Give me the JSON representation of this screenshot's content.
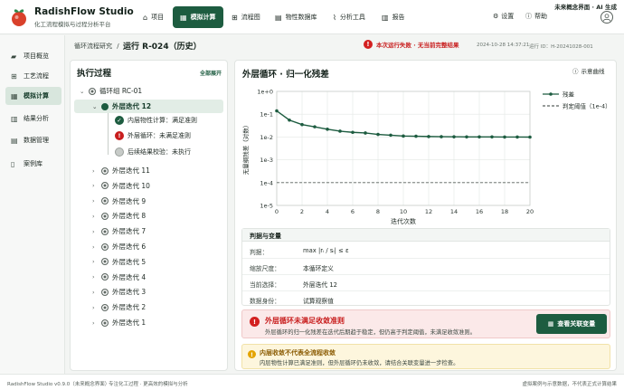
{
  "app": {
    "title": "RadishFlow Studio",
    "subtitle": "化工流程模拟与过程分析平台",
    "concept_tag": "未来概念界面 · AI 生成",
    "brand_color": "#1d5c40"
  },
  "nav": [
    {
      "label": "项目",
      "icon": "home-icon",
      "active": false
    },
    {
      "label": "模拟计算",
      "icon": "grid-icon",
      "active": true
    },
    {
      "label": "流程图",
      "icon": "flow-icon",
      "active": false
    },
    {
      "label": "物性数据库",
      "icon": "database-icon",
      "active": false
    },
    {
      "label": "分析工具",
      "icon": "chart-icon",
      "active": false
    },
    {
      "label": "报告",
      "icon": "report-icon",
      "active": false
    }
  ],
  "top_right": {
    "settings": "设置",
    "help": "帮助"
  },
  "sidebar": [
    {
      "label": "项目概览",
      "icon": "folder-icon",
      "active": false
    },
    {
      "label": "工艺流程",
      "icon": "process-icon",
      "active": false
    },
    {
      "label": "模拟计算",
      "icon": "grid-icon",
      "active": true
    },
    {
      "label": "结果分析",
      "icon": "bar-chart-icon",
      "active": false
    },
    {
      "label": "数据管理",
      "icon": "database-icon",
      "active": false
    },
    {
      "label": "案例库",
      "icon": "book-icon",
      "active": false
    }
  ],
  "header": {
    "breadcrumb": "循环流程研究",
    "separator": "/",
    "run_title": "运行 R-024（历史）",
    "alert": "本次运行失败 · 无当前完整结果",
    "run_time": "2024-10-28 14:37:21",
    "run_id": "运行 ID：H-20241028-001"
  },
  "execution": {
    "title": "执行过程",
    "expand_all": "全部展开",
    "root": "循环组 RC-01",
    "current": "外层迭代 12",
    "checks": [
      {
        "label": "内层物性计算：满足准则",
        "status": "ok"
      },
      {
        "label": "外层循环：未满足准则",
        "status": "bad"
      },
      {
        "label": "后续结果校验：未执行",
        "status": "pending"
      }
    ],
    "others": [
      "外层迭代 11",
      "外层迭代 10",
      "外层迭代 9",
      "外层迭代 8",
      "外层迭代 7",
      "外层迭代 6",
      "外层迭代 5",
      "外层迭代 4",
      "外层迭代 3",
      "外层迭代 2",
      "外层迭代 1"
    ]
  },
  "main": {
    "title": "外层循环 · 归一化残差",
    "legend_btn": "示意曲线"
  },
  "chart_data": {
    "type": "line",
    "title": "",
    "xlabel": "迭代次数",
    "ylabel": "无量纲残差（对数）",
    "y_scale": "log",
    "ylim_exp": [
      -5,
      0
    ],
    "xlim": [
      0,
      20
    ],
    "x_ticks": [
      "0",
      "2",
      "4",
      "6",
      "8",
      "10",
      "12",
      "14",
      "16",
      "18",
      "20"
    ],
    "y_ticks": [
      "1e+0",
      "1e-1",
      "1e-2",
      "1e-3",
      "1e-4",
      "1e-5"
    ],
    "series": [
      {
        "name": "残差",
        "color": "#1d5c40",
        "x": [
          0,
          1,
          2,
          3,
          4,
          5,
          6,
          7,
          8,
          9,
          10,
          11,
          12,
          13,
          14,
          15,
          16,
          17,
          18,
          19,
          20
        ],
        "y": [
          0.14,
          0.055,
          0.035,
          0.028,
          0.022,
          0.018,
          0.016,
          0.015,
          0.013,
          0.012,
          0.011,
          0.0108,
          0.0105,
          0.0103,
          0.0102,
          0.0101,
          0.0101,
          0.0101,
          0.01,
          0.01,
          0.0099
        ]
      },
      {
        "name": "判定阈值（1e-4）",
        "color": "#59625d",
        "dashed": true,
        "x": [
          0,
          20
        ],
        "y": [
          0.0001,
          0.0001
        ]
      }
    ],
    "grid": true,
    "legend_position": "top-right"
  },
  "props": {
    "title": "判据与变量",
    "rows": [
      {
        "key": "判据：",
        "value": "max |rᵢ / sᵢ| ≤ ε"
      },
      {
        "key": "缩放尺度：",
        "value": "本循环定义"
      },
      {
        "key": "当前选择：",
        "value": "外层迭代 12"
      },
      {
        "key": "数据身份：",
        "value": "试算观察值"
      }
    ]
  },
  "alert_red": {
    "title": "外层循环未满足收敛准则",
    "text": "外层循环的归一化残差在迭代后期趋于稳定，但仍高于判定阈值，未满足收敛准则。",
    "button": "查看关联变量"
  },
  "alert_yellow": {
    "title": "内层收敛不代表全流程收敛",
    "text": "内层物性计算已满足准则，但外层循环仍未收敛，请结合关联变量进一步检查。"
  },
  "footer": {
    "version": "RadishFlow Studio  v0.9.0（未来概念界面）",
    "tagline": "专注化工过程 · 更高效的模拟与分析",
    "disclaimer": "虚拟案例与示意数据，不代表正式计算结果"
  }
}
